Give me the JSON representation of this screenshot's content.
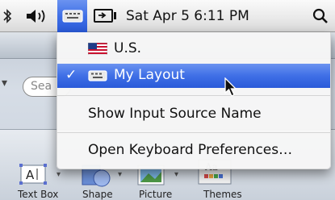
{
  "menubar": {
    "clock": "Sat Apr 5  6:11 PM"
  },
  "input_menu": {
    "items": [
      {
        "label": "U.S.",
        "icon": "us-flag-icon",
        "checked": false
      },
      {
        "label": "My Layout",
        "icon": "keyboard-icon",
        "checked": true
      }
    ],
    "show_name_label": "Show Input Source Name",
    "open_prefs_label": "Open Keyboard Preferences…"
  },
  "app": {
    "search_placeholder": "Sea",
    "ribbon": {
      "text_box_label": "Text Box",
      "shape_label": "Shape",
      "picture_label": "Picture",
      "themes_label": "Themes",
      "themes_preview_text": "Aa"
    }
  },
  "colors": {
    "highlight": "#3f6fe6"
  }
}
